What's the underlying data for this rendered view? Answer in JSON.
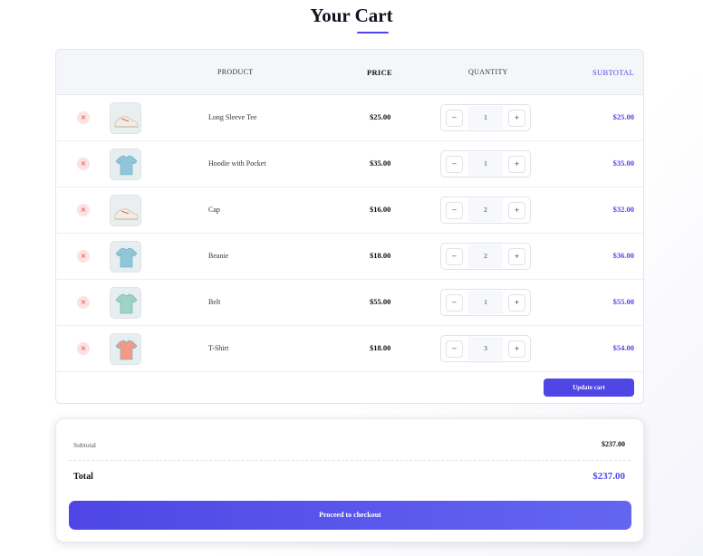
{
  "page": {
    "title": "Your Cart"
  },
  "table": {
    "headers": {
      "product": "PRODUCT",
      "price": "PRICE",
      "quantity": "QUANTITY",
      "subtotal": "SUBTOTAL"
    },
    "rows": [
      {
        "name": "Long Sleeve Tee",
        "price": "$25.00",
        "quantity": "1",
        "subtotal": "$25.00",
        "image": "sneaker-icon"
      },
      {
        "name": "Hoodie with Pocket",
        "price": "$35.00",
        "quantity": "1",
        "subtotal": "$35.00",
        "image": "tshirt-icon"
      },
      {
        "name": "Cap",
        "price": "$16.00",
        "quantity": "2",
        "subtotal": "$32.00",
        "image": "sneaker-icon"
      },
      {
        "name": "Beanie",
        "price": "$18.00",
        "quantity": "2",
        "subtotal": "$36.00",
        "image": "tshirt-icon"
      },
      {
        "name": "Belt",
        "price": "$55.00",
        "quantity": "1",
        "subtotal": "$55.00",
        "image": "tshirt-icon"
      },
      {
        "name": "T-Shirt",
        "price": "$18.00",
        "quantity": "3",
        "subtotal": "$54.00",
        "image": "tshirt-icon"
      }
    ],
    "remove_glyph": "×",
    "minus_glyph": "−",
    "plus_glyph": "+",
    "update_label": "Update cart"
  },
  "summary": {
    "subtotal_label": "Subtotal",
    "subtotal_value": "$237.00",
    "total_label": "Total",
    "total_value": "$237.00",
    "checkout_label": "Proceed to checkout"
  },
  "colors": {
    "accent": "#4f46e5",
    "remove_bg": "#fde2e2",
    "remove_fg": "#e04545"
  }
}
